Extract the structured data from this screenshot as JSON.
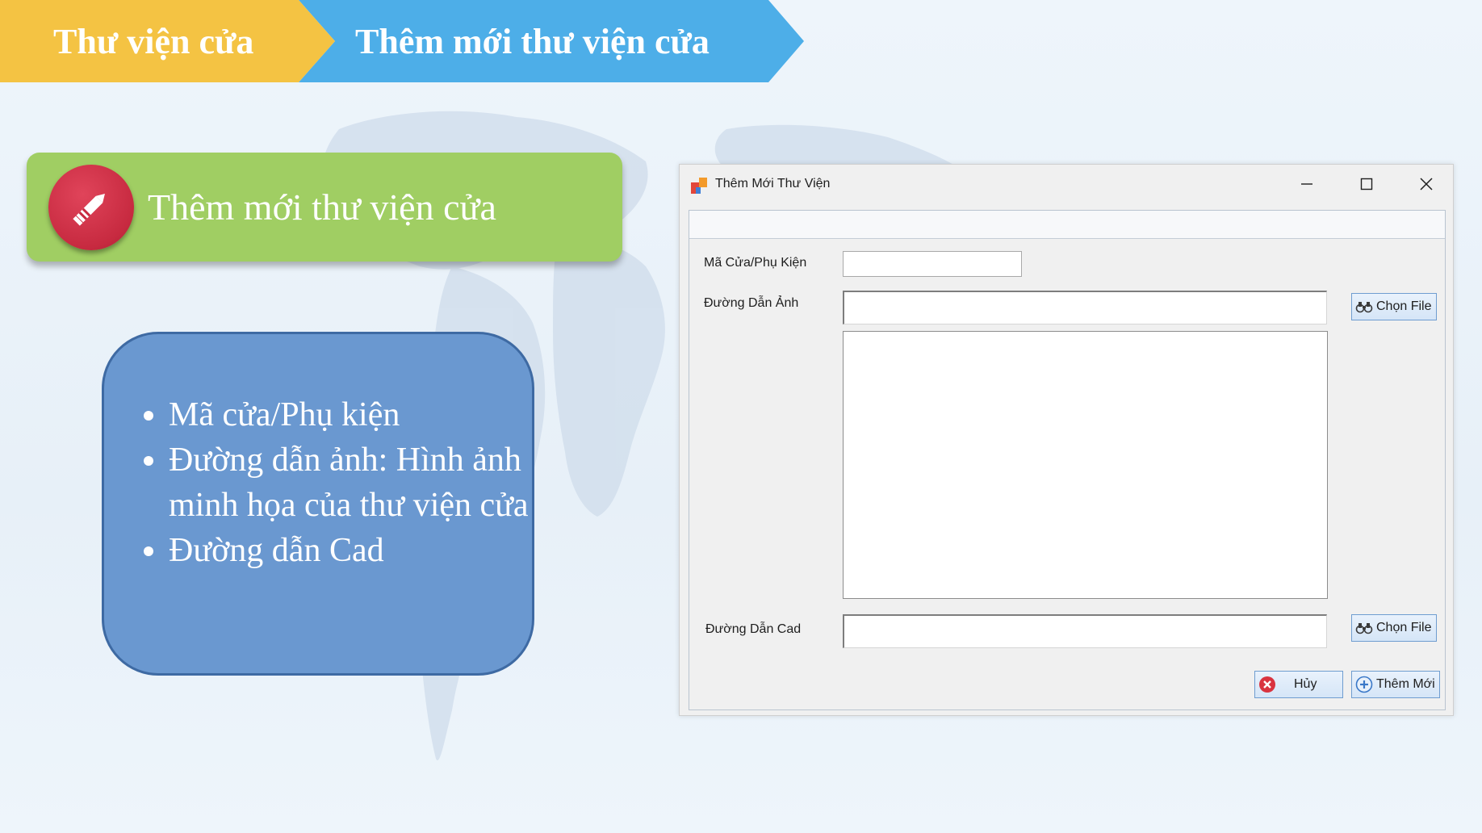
{
  "breadcrumb": {
    "items": [
      "Thư viện cửa",
      "Thêm mới thư viện cửa"
    ]
  },
  "header_card": {
    "title": "Thêm mới thư viện cửa",
    "icon": "pencil-icon"
  },
  "info_box": {
    "bullets": [
      "Mã cửa/Phụ kiện",
      "Đường dẫn ảnh: Hình ảnh minh họa của thư viện cửa",
      "Đường dẫn Cad"
    ]
  },
  "dialog": {
    "title": "Thêm Mới Thư Viện",
    "fields": {
      "code_label": "Mã Cửa/Phụ Kiện",
      "code_value": "",
      "image_path_label": "Đường Dẫn Ảnh",
      "image_path_value": "",
      "cad_path_label": "Đường Dẫn Cad",
      "cad_path_value": ""
    },
    "buttons": {
      "choose_file_image": "Chọn File",
      "choose_file_cad": "Chọn File",
      "cancel": "Hủy",
      "add_new": "Thêm Mới"
    }
  },
  "colors": {
    "crumb_primary": "#f4c343",
    "crumb_secondary": "#4daee8",
    "header_card": "#a0ce63",
    "badge": "#c72a40",
    "info_box": "#6a98d0"
  }
}
